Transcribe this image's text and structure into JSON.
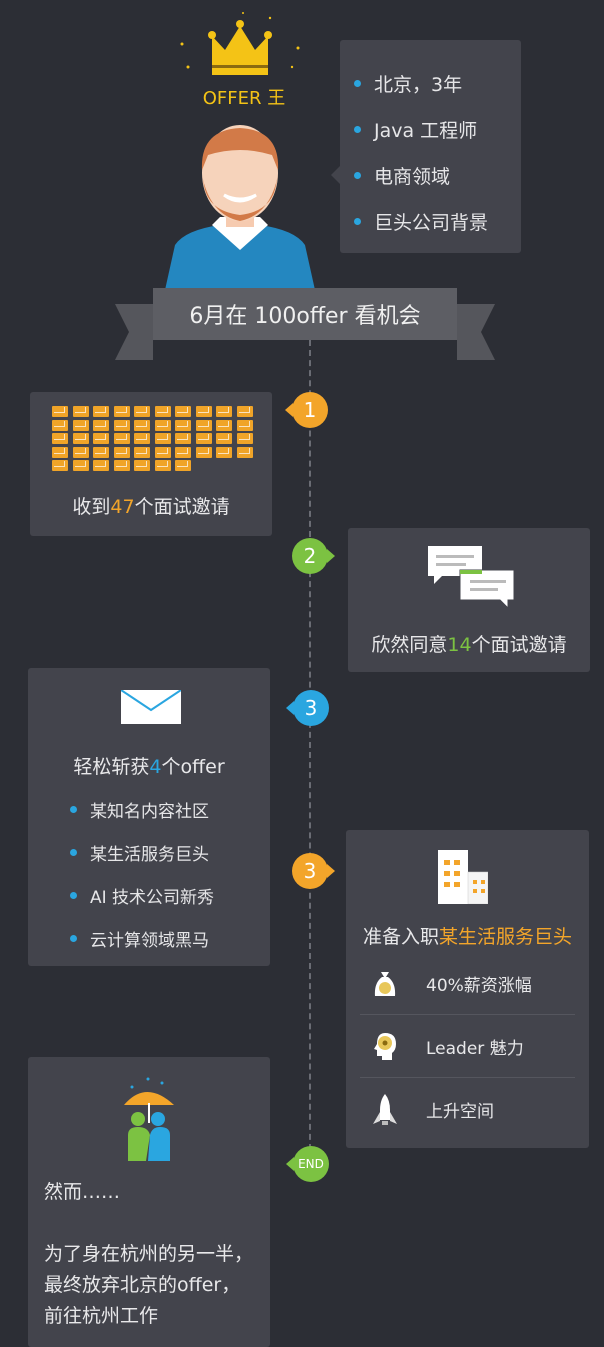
{
  "crown_label": "OFFER 王",
  "profile": [
    "北京，3年",
    "Java 工程师",
    "电商领域",
    "巨头公司背景"
  ],
  "banner": "6月在 100offer 看机会",
  "colors": {
    "orange": "#f3a52a",
    "green": "#7cc242",
    "blue": "#2aa6e0",
    "card": "#43444c",
    "background": "#2c2e35"
  },
  "step1": {
    "badge": "1",
    "pre": "收到",
    "num": "47",
    "post": "个面试邀请",
    "envelope_count": 47
  },
  "step2": {
    "badge": "2",
    "pre": "欣然同意",
    "num": "14",
    "post": "个面试邀请"
  },
  "step3": {
    "badge": "3",
    "pre": "轻松斩获",
    "num": "4",
    "post": "个offer",
    "items": [
      "某知名内容社区",
      "某生活服务巨头",
      "AI 技术公司新秀",
      "云计算领域黑马"
    ]
  },
  "step4": {
    "badge": "3",
    "pre": "准备入职",
    "highlight": "某生活服务巨头",
    "benefits": [
      {
        "icon": "money-bag-icon",
        "label": "40%薪资涨幅"
      },
      {
        "icon": "head-gear-icon",
        "label": "Leader 魅力"
      },
      {
        "icon": "rocket-icon",
        "label": "上升空间"
      }
    ]
  },
  "end": {
    "badge": "END",
    "line1": "然而……",
    "line2": "为了身在杭州的另一半，最终放弃北京的offer，前往杭州工作"
  }
}
